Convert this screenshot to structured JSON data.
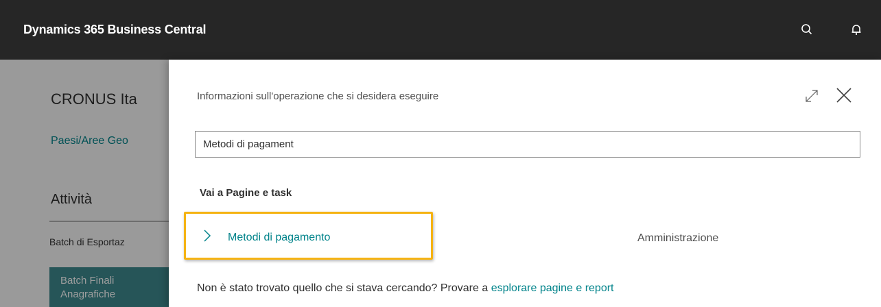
{
  "app": {
    "title": "Dynamics 365 Business Central"
  },
  "topbar": {
    "search_icon": "search-icon",
    "bell_icon": "bell-icon"
  },
  "background": {
    "company": "CRONUS Ita",
    "link": "Paesi/Aree Geo",
    "section": "Attività",
    "batch": "Batch di Esportaz",
    "tile": {
      "line1": "Batch Finali",
      "line2": "Anagrafiche"
    }
  },
  "dialog": {
    "title": "Informazioni sull'operazione che si desidera eseguire",
    "search_value": "Metodi di pagament",
    "section_heading": "Vai a Pagine e task",
    "result": {
      "label": "Metodi di pagamento",
      "category": "Amministrazione"
    },
    "footer": {
      "text": "Non è stato trovato quello che si stava cercando? Provare a",
      "link": "esplorare pagine e report"
    }
  },
  "colors": {
    "topbar": "#262626",
    "accent": "#00838a",
    "highlight": "#f5b313",
    "tile": "#3e8a8f"
  }
}
